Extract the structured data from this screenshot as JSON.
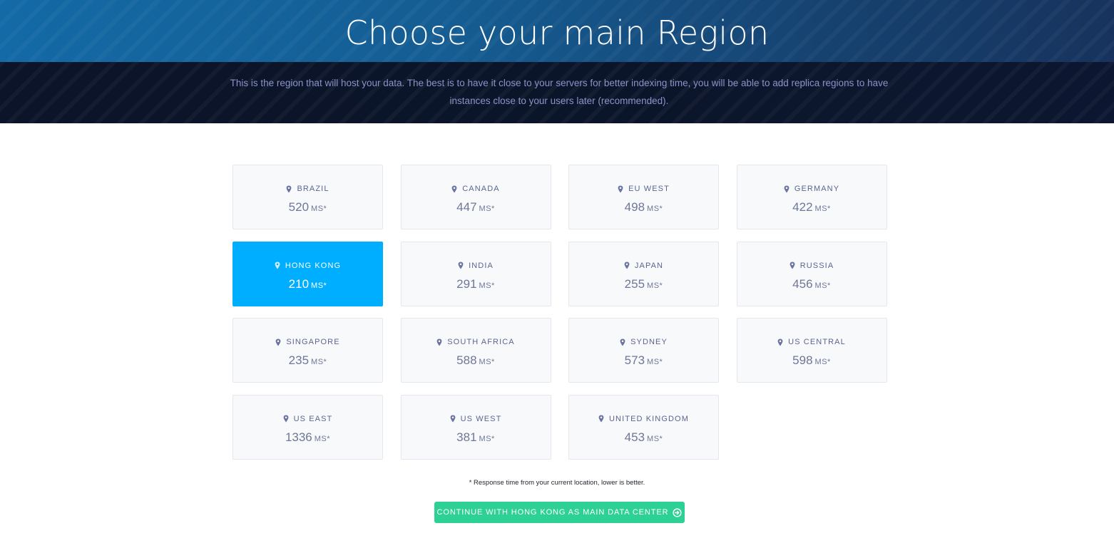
{
  "header": {
    "title": "Choose your main Region",
    "description": "This is the region that will host your data. The best is to have it close to your servers for better indexing time, you will be able to add replica regions to have instances close to your users later (recommended)."
  },
  "regions": [
    {
      "name": "BRAZIL",
      "latency": "520",
      "unit": "MS*",
      "selected": false
    },
    {
      "name": "CANADA",
      "latency": "447",
      "unit": "MS*",
      "selected": false
    },
    {
      "name": "EU WEST",
      "latency": "498",
      "unit": "MS*",
      "selected": false
    },
    {
      "name": "GERMANY",
      "latency": "422",
      "unit": "MS*",
      "selected": false
    },
    {
      "name": "HONG KONG",
      "latency": "210",
      "unit": "MS*",
      "selected": true
    },
    {
      "name": "INDIA",
      "latency": "291",
      "unit": "MS*",
      "selected": false
    },
    {
      "name": "JAPAN",
      "latency": "255",
      "unit": "MS*",
      "selected": false
    },
    {
      "name": "RUSSIA",
      "latency": "456",
      "unit": "MS*",
      "selected": false
    },
    {
      "name": "SINGAPORE",
      "latency": "235",
      "unit": "MS*",
      "selected": false
    },
    {
      "name": "SOUTH AFRICA",
      "latency": "588",
      "unit": "MS*",
      "selected": false
    },
    {
      "name": "SYDNEY",
      "latency": "573",
      "unit": "MS*",
      "selected": false
    },
    {
      "name": "US CENTRAL",
      "latency": "598",
      "unit": "MS*",
      "selected": false
    },
    {
      "name": "US EAST",
      "latency": "1336",
      "unit": "MS*",
      "selected": false
    },
    {
      "name": "US WEST",
      "latency": "381",
      "unit": "MS*",
      "selected": false
    },
    {
      "name": "UNITED KINGDOM",
      "latency": "453",
      "unit": "MS*",
      "selected": false
    }
  ],
  "footnote": "* Response time from your current location, lower is better.",
  "continue_button": {
    "label": "CONTINUE WITH HONG KONG AS MAIN DATA CENTER",
    "icon": "arrow-right-circle-icon"
  },
  "colors": {
    "selected": "#00aeff",
    "button": "#2dd196",
    "header_start": "#136aa6",
    "subbar": "#0b1429"
  }
}
